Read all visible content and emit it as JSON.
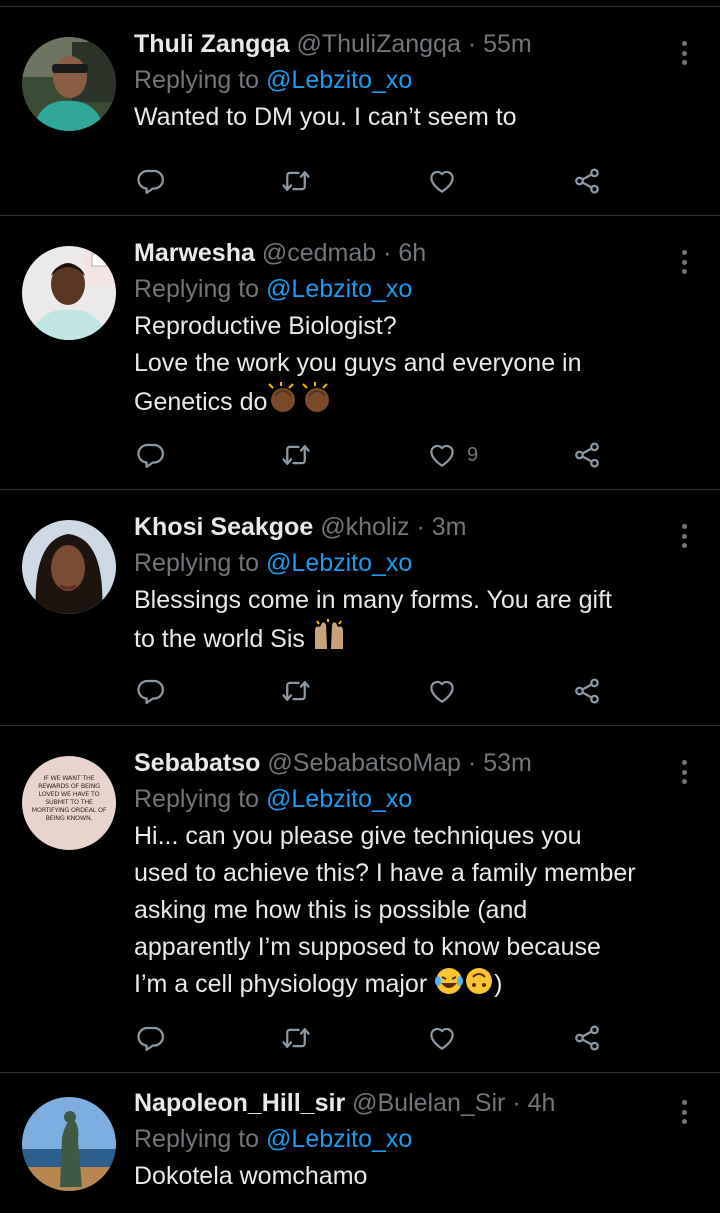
{
  "tweets": [
    {
      "name": "Thuli Zangqa",
      "handle": "@ThuliZangqa",
      "separator": "·",
      "time": "55m",
      "replying_prefix": "Replying to",
      "replying_to": "@Lebzito_xo",
      "text": "Wanted to DM you. I can’t seem to",
      "like_count": ""
    },
    {
      "name": "Marwesha",
      "handle": "@cedmab",
      "separator": "·",
      "time": "6h",
      "replying_prefix": "Replying to",
      "replying_to": "@Lebzito_xo",
      "text": "Reproductive Biologist?\nLove the work you guys and everyone in\nGenetics do",
      "like_count": "9"
    },
    {
      "name": "Khosi Seakgoe",
      "handle": "@kholiz",
      "separator": "·",
      "time": "3m",
      "replying_prefix": "Replying to",
      "replying_to": "@Lebzito_xo",
      "text": "Blessings come in many forms. You are gift\nto the world Sis",
      "like_count": ""
    },
    {
      "name": "Sebabatso",
      "handle": "@SebabatsoMap",
      "separator": "·",
      "time": "53m",
      "replying_prefix": "Replying to",
      "replying_to": "@Lebzito_xo",
      "text": "Hi... can you please give techniques you\nused to achieve this? I have a family member\nasking me how this is possible (and\napparently I’m supposed to know because\nI’m a cell physiology major",
      "text_tail": ")",
      "like_count": "",
      "avatar_text": "IF WE WANT THE REWARDS OF BEING LOVED WE HAVE TO SUBMIT TO THE MORTIFYING ORDEAL OF BEING KNOWN."
    },
    {
      "name": "Napoleon_Hill_sir",
      "handle": "@Bulelan_Sir",
      "separator": "·",
      "time": "4h",
      "replying_prefix": "Replying to",
      "replying_to": "@Lebzito_xo",
      "text": "Dokotela womchamo",
      "like_count": ""
    }
  ],
  "icons": [
    "more-vertical-icon",
    "reply-icon",
    "retweet-icon",
    "like-icon",
    "share-icon"
  ],
  "colors": {
    "background": "#000000",
    "text": "#e7e9ea",
    "muted": "#71767b",
    "link": "#1d9bf0",
    "divider": "#2f3336"
  }
}
